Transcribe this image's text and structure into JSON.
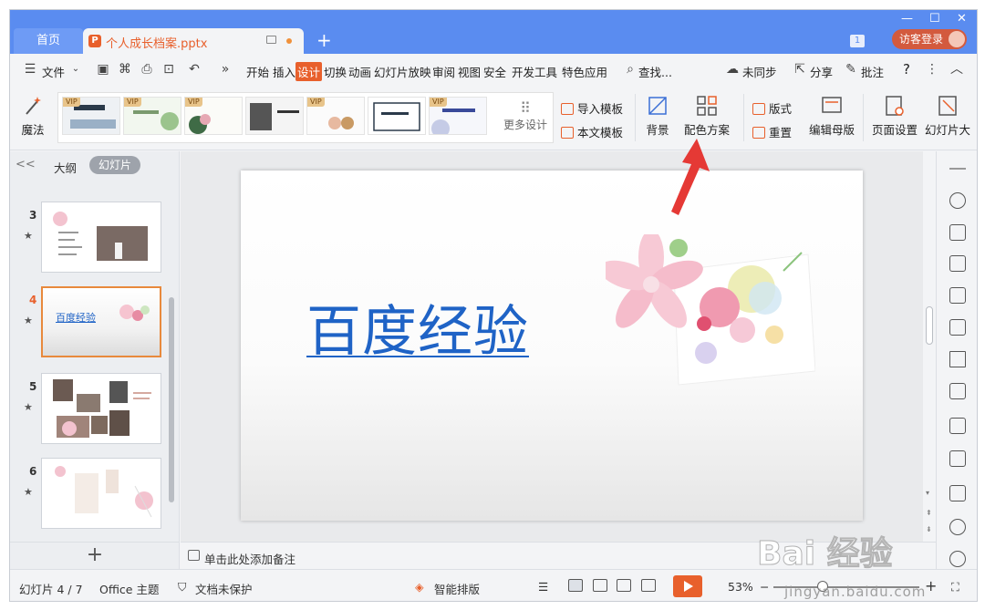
{
  "titlebar": {
    "home_tab": "首页",
    "doc_tab": "个人成长档案.pptx",
    "ppt_badge": "P",
    "new_tab_symbol": "+",
    "window_count": "1",
    "login_label": "访客登录"
  },
  "menubar": {
    "file_label": "文件",
    "tabs": [
      "开始",
      "插入",
      "设计",
      "切换",
      "动画",
      "幻灯片放映",
      "审阅",
      "视图",
      "安全",
      "开发工具",
      "特色应用"
    ],
    "active_tab": "设计",
    "search_label": "查找...",
    "sync_label": "未同步",
    "share_label": "分享",
    "comment_label": "批注",
    "help_symbol": "?"
  },
  "ribbon": {
    "magic_label": "魔法",
    "vip_badge": "VIP",
    "more_design": "更多设计",
    "import_template": "导入模板",
    "this_template": "本文模板",
    "background": "背景",
    "color_scheme": "配色方案",
    "layout": "版式",
    "reset": "重置",
    "edit_master": "编辑母版",
    "page_setup": "页面设置",
    "slide_size": "幻灯片大"
  },
  "left_panel": {
    "outline_tab": "大纲",
    "slides_tab": "幻灯片",
    "collapse_symbol": "<<",
    "add_symbol": "+",
    "slides": [
      {
        "number": "3",
        "selected": false
      },
      {
        "number": "4",
        "selected": true,
        "title": "百度经验"
      },
      {
        "number": "5",
        "selected": false
      },
      {
        "number": "6",
        "selected": false
      }
    ]
  },
  "slide": {
    "title": "百度经验"
  },
  "notes": {
    "placeholder": "单击此处添加备注"
  },
  "statusbar": {
    "slide_counter": "幻灯片 4 / 7",
    "theme": "Office 主题",
    "protection": "文档未保护",
    "smart_layout": "智能排版",
    "zoom": "53%",
    "zoom_minus": "−",
    "zoom_plus": "+"
  },
  "watermark": {
    "brand": "Bai 经验",
    "url": "jingyan.baidu.com"
  },
  "colors": {
    "title_bar": "#5a8cf0",
    "accent": "#e8602c",
    "slide_title": "#1f63c6",
    "arrow": "#e53935"
  }
}
